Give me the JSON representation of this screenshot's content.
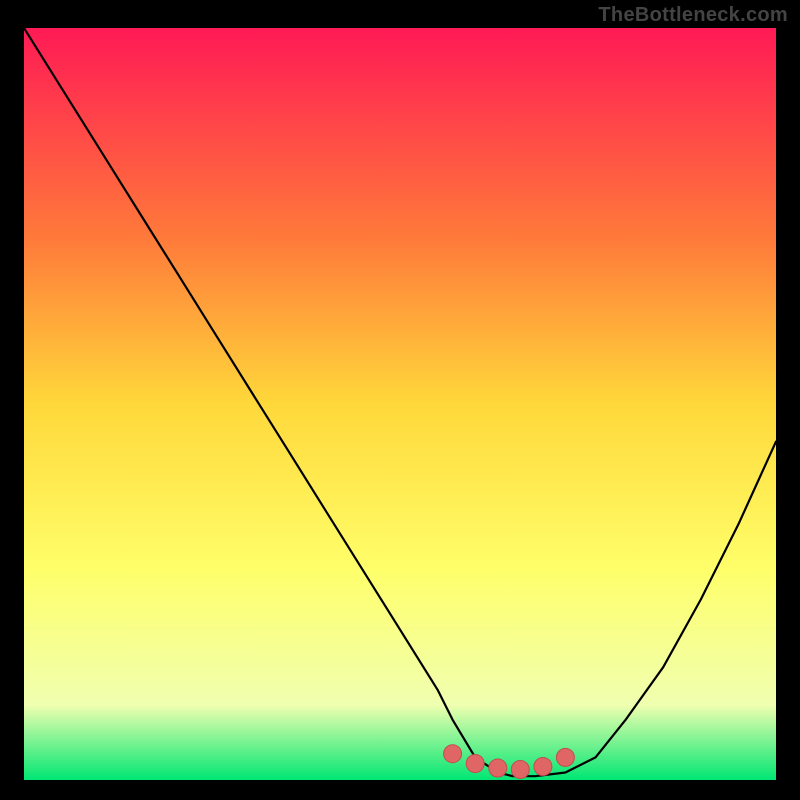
{
  "watermark": "TheBottleneck.com",
  "colors": {
    "page_bg": "#000000",
    "grad_top": "#ff1a55",
    "grad_mid_upper": "#ff7a3a",
    "grad_mid": "#ffd83a",
    "grad_mid_lower": "#ffff6a",
    "grad_lower": "#f0ffb0",
    "grad_bottom": "#00e673",
    "curve": "#000000",
    "dot_fill": "#e06666",
    "dot_stroke": "#c24d4d"
  },
  "chart_data": {
    "type": "line",
    "title": "",
    "xlabel": "",
    "ylabel": "",
    "xlim": [
      0,
      100
    ],
    "ylim": [
      0,
      100
    ],
    "grid": false,
    "series": [
      {
        "name": "bottleneck-curve",
        "x": [
          0,
          5,
          10,
          15,
          20,
          25,
          30,
          35,
          40,
          45,
          50,
          55,
          57,
          60,
          63,
          65,
          68,
          72,
          76,
          80,
          85,
          90,
          95,
          100
        ],
        "y": [
          100,
          92,
          84,
          76,
          68,
          60,
          52,
          44,
          36,
          28,
          20,
          12,
          8,
          3,
          1,
          0.5,
          0.5,
          1,
          3,
          8,
          15,
          24,
          34,
          45
        ]
      }
    ],
    "highlight": {
      "name": "optimal-range",
      "x": [
        57,
        60,
        63,
        66,
        69,
        72
      ],
      "y": [
        3.5,
        2.2,
        1.6,
        1.4,
        1.8,
        3.0
      ]
    }
  }
}
